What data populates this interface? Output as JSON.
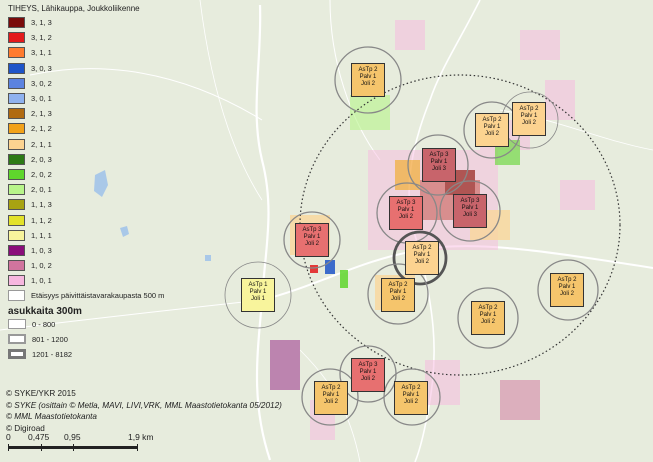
{
  "legend": {
    "title": "TIHEYS, Lähikauppa, Joukkoliikenne",
    "classes": [
      {
        "label": "3, 1, 3",
        "color": "#7a0b0b"
      },
      {
        "label": "3, 1, 2",
        "color": "#e31a1c"
      },
      {
        "label": "3, 1, 1",
        "color": "#ff7b2e"
      },
      {
        "label": "3, 0, 3",
        "color": "#1f55c8"
      },
      {
        "label": "3, 0, 2",
        "color": "#5b83e0"
      },
      {
        "label": "3, 0, 1",
        "color": "#8fb2ef"
      },
      {
        "label": "2, 1, 3",
        "color": "#b06a10"
      },
      {
        "label": "2, 1, 2",
        "color": "#f2a21a"
      },
      {
        "label": "2, 1, 1",
        "color": "#fcd390"
      },
      {
        "label": "2, 0, 3",
        "color": "#2d7a15"
      },
      {
        "label": "2, 0, 2",
        "color": "#5fd62c"
      },
      {
        "label": "2, 0, 1",
        "color": "#b8f58a"
      },
      {
        "label": "1, 1, 3",
        "color": "#a8a312"
      },
      {
        "label": "1, 1, 2",
        "color": "#e3e22a"
      },
      {
        "label": "1, 1, 1",
        "color": "#f8f49c"
      },
      {
        "label": "1, 0, 3",
        "color": "#8a0d7a"
      },
      {
        "label": "1, 0, 2",
        "color": "#d1749e"
      },
      {
        "label": "1, 0, 1",
        "color": "#f7b7df"
      }
    ],
    "distance_label": "Etäisyys päivittäistavarakaupasta 500 m",
    "pop_title": "asukkaita 300m",
    "pop_classes": [
      "0 - 800",
      "801 - 1200",
      "1201 - 8182"
    ]
  },
  "credits": [
    "© SYKE/YKR 2015",
    "© SYKE (osittain © Metla, MAVI, LIVI,VRK, MML Maastotietokanta 05/2012)",
    "© MML Maastotietokanta",
    "© Digiroad"
  ],
  "scale": {
    "labels": [
      "0",
      "0,475",
      "0,95",
      "1,9 km"
    ]
  },
  "boxes": [
    {
      "lines": [
        "AsTp 2",
        "Palv 1",
        "Joli 2"
      ],
      "fill": "#f5c56c"
    },
    {
      "lines": [
        "AsTp 2",
        "Palv 1",
        "Joli 2"
      ],
      "fill": "#fcd390"
    },
    {
      "lines": [
        "AsTp 2",
        "Palv 1",
        "Joli 2"
      ],
      "fill": "#fcd390"
    },
    {
      "lines": [
        "AsTp 3",
        "Palv 1",
        "Joli 3"
      ],
      "fill": "#c8646b"
    },
    {
      "lines": [
        "AsTp 3",
        "Palv 1",
        "Joli 2"
      ],
      "fill": "#e77070"
    },
    {
      "lines": [
        "AsTp 3",
        "Palv 1",
        "Joli 3"
      ],
      "fill": "#c8646b"
    },
    {
      "lines": [
        "AsTp 2",
        "Palv 1",
        "Joli 2"
      ],
      "fill": "#fcd390"
    },
    {
      "lines": [
        "AsTp 3",
        "Palv 1",
        "Joli 2"
      ],
      "fill": "#e77070"
    },
    {
      "lines": [
        "AsTp 1",
        "Palv 1",
        "Joli 1"
      ],
      "fill": "#f8f49c"
    },
    {
      "lines": [
        "AsTp 2",
        "Palv 1",
        "Joli 2"
      ],
      "fill": "#f5c56c"
    },
    {
      "lines": [
        "AsTp 2",
        "Palv 1",
        "Joli 2"
      ],
      "fill": "#f5c56c"
    },
    {
      "lines": [
        "AsTp 2",
        "Palv 1",
        "Joli 2"
      ],
      "fill": "#f5c56c"
    },
    {
      "lines": [
        "AsTp 3",
        "Palv 1",
        "Joli 2"
      ],
      "fill": "#e77070"
    },
    {
      "lines": [
        "AsTp 2",
        "Palv 1",
        "Joli 2"
      ],
      "fill": "#f5c56c"
    },
    {
      "lines": [
        "AsTp 2",
        "Palv 1",
        "Joli 2"
      ],
      "fill": "#f5c56c"
    }
  ]
}
